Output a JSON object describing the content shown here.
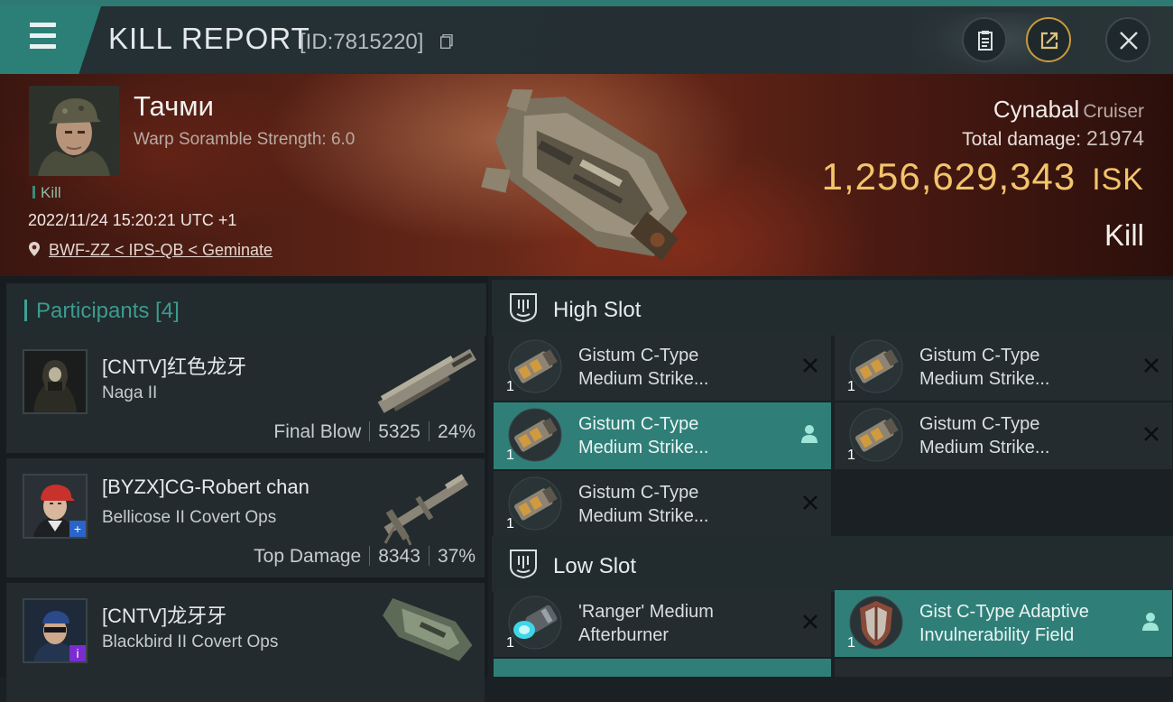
{
  "header": {
    "title": "KILL REPORT",
    "report_id": "[ID:7815220]"
  },
  "victim": {
    "name": "Тачми",
    "scramble": "Warp Soramble Strength: 6.0",
    "kill_tag": "Kill",
    "datetime": "2022/11/24 15:20:21 UTC +1",
    "location": "BWF-ZZ < IPS-QB < Geminate",
    "ship": "Cynabal",
    "ship_class": "Cruiser",
    "total_damage_label": "Total damage:",
    "total_damage": "21974",
    "isk_value": "1,256,629,343",
    "isk_unit": "ISK",
    "result": "Kill"
  },
  "participants": {
    "title": "Participants [4]",
    "items": [
      {
        "name": "[CNTV]红色龙牙",
        "ship": "Naga II",
        "role": "Final Blow",
        "damage": "5325",
        "percent": "24%"
      },
      {
        "name": "[BYZX]CG-Robert chan",
        "ship": "Bellicose II Covert Ops",
        "role": "Top Damage",
        "damage": "8343",
        "percent": "37%"
      },
      {
        "name": "[CNTV]龙牙牙",
        "ship": "Blackbird II Covert Ops"
      }
    ]
  },
  "slots": {
    "high": {
      "title": "High Slot",
      "modules": [
        {
          "line1": "Gistum C-Type",
          "line2": "Medium Strike...",
          "qty": "1",
          "state": "destroyed"
        },
        {
          "line1": "Gistum C-Type",
          "line2": "Medium Strike...",
          "qty": "1",
          "state": "destroyed"
        },
        {
          "line1": "Gistum C-Type",
          "line2": "Medium Strike...",
          "qty": "1",
          "state": "dropped"
        },
        {
          "line1": "Gistum C-Type",
          "line2": "Medium Strike...",
          "qty": "1",
          "state": "destroyed"
        },
        {
          "line1": "Gistum C-Type",
          "line2": "Medium Strike...",
          "qty": "1",
          "state": "destroyed"
        }
      ]
    },
    "low": {
      "title": "Low Slot",
      "modules": [
        {
          "line1": "'Ranger' Medium",
          "line2": "Afterburner",
          "qty": "1",
          "state": "destroyed"
        },
        {
          "line1": "Gist C-Type Adaptive",
          "line2": "Invulnerability Field",
          "qty": "1",
          "state": "dropped"
        }
      ]
    }
  },
  "colors": {
    "accent": "#2b7f77",
    "isk": "#f2c46c",
    "dropped_highlight": "#2f7f78"
  }
}
